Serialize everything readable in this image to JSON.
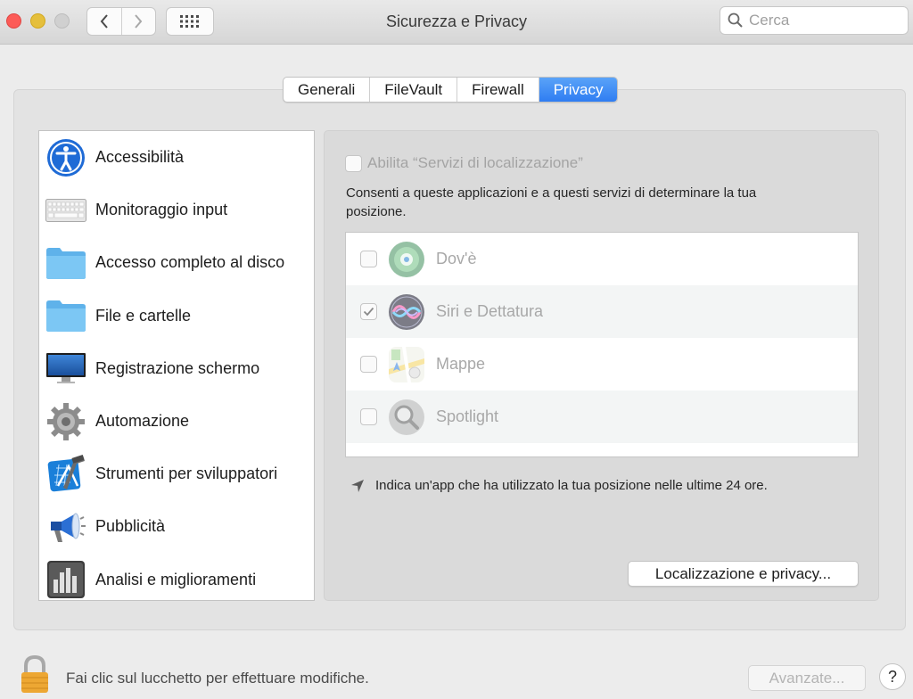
{
  "window": {
    "title": "Sicurezza e Privacy"
  },
  "search": {
    "placeholder": "Cerca"
  },
  "tabs": [
    {
      "label": "Generali",
      "active": false
    },
    {
      "label": "FileVault",
      "active": false
    },
    {
      "label": "Firewall",
      "active": false
    },
    {
      "label": "Privacy",
      "active": true
    }
  ],
  "sidebar": {
    "items": [
      {
        "label": "Accessibilità",
        "icon": "accessibility-icon"
      },
      {
        "label": "Monitoraggio input",
        "icon": "keyboard-icon"
      },
      {
        "label": "Accesso completo al disco",
        "icon": "folder-icon"
      },
      {
        "label": "File e cartelle",
        "icon": "folder-icon"
      },
      {
        "label": "Registrazione schermo",
        "icon": "display-icon"
      },
      {
        "label": "Automazione",
        "icon": "gear-icon"
      },
      {
        "label": "Strumenti per sviluppatori",
        "icon": "xcode-icon"
      },
      {
        "label": "Pubblicità",
        "icon": "megaphone-icon"
      },
      {
        "label": "Analisi e miglioramenti",
        "icon": "bar-chart-icon"
      }
    ]
  },
  "location": {
    "enable_label": "Abilita “Servizi di localizzazione”",
    "enabled": false,
    "description": "Consenti a queste applicazioni e a questi servizi di determinare la tua posizione.",
    "apps": [
      {
        "name": "Dov'è",
        "checked": false,
        "icon": "find-my-icon"
      },
      {
        "name": "Siri e Dettatura",
        "checked": true,
        "icon": "siri-icon"
      },
      {
        "name": "Mappe",
        "checked": false,
        "icon": "maps-icon"
      },
      {
        "name": "Spotlight",
        "checked": false,
        "icon": "spotlight-icon"
      }
    ],
    "note": "Indica un'app che ha utilizzato la tua posizione nelle ultime 24 ore.",
    "button_label": "Localizzazione e privacy..."
  },
  "footer": {
    "lock_label": "Fai clic sul lucchetto per effettuare modifiche.",
    "advanced_label": "Avanzate...",
    "help_label": "?"
  }
}
